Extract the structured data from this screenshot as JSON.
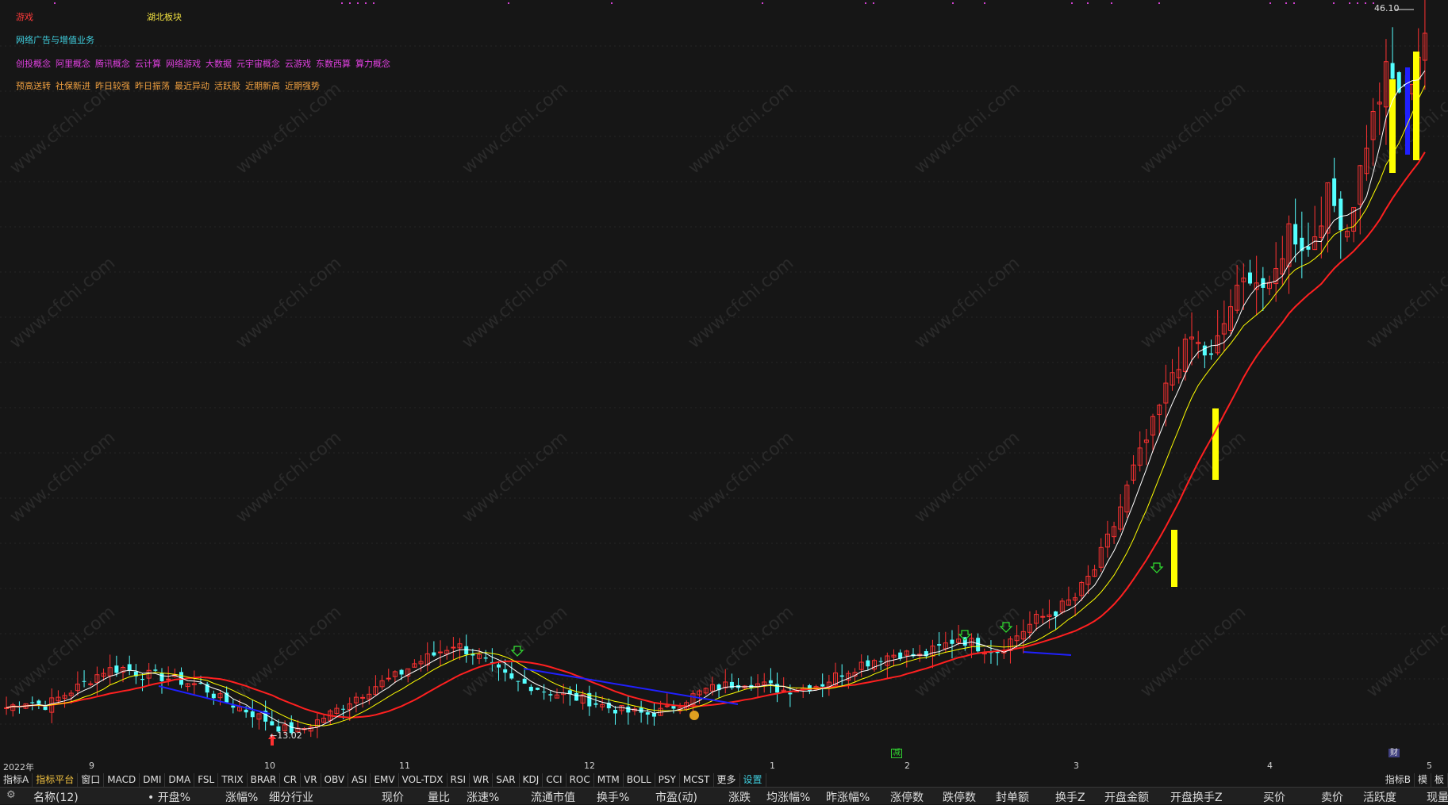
{
  "tags": {
    "sector1": "游戏",
    "sector2": "湖北板块",
    "industry": "网络广告与增值业务",
    "concepts": [
      "创投概念",
      "阿里概念",
      "腾讯概念",
      "云计算",
      "网络游戏",
      "大数据",
      "元宇宙概念",
      "云游戏",
      "东数西算",
      "算力概念"
    ],
    "styles": [
      "预高送转",
      "社保新进",
      "昨日较强",
      "昨日振荡",
      "最近异动",
      "活跃股",
      "近期新高",
      "近期强势"
    ]
  },
  "price_max_label": "46.10",
  "price_min_label": "←13.02",
  "date_axis": {
    "year": "2022年",
    "labels": [
      "9",
      "10",
      "11",
      "12",
      "1",
      "2",
      "3",
      "4",
      "5"
    ]
  },
  "markers": {
    "jian": "减",
    "caibao": "财"
  },
  "watermark": "www.cfchi.com",
  "indicator_tabs": [
    "指标A",
    "指标平台",
    "窗口",
    "MACD",
    "DMI",
    "DMA",
    "FSL",
    "TRIX",
    "BRAR",
    "CR",
    "VR",
    "OBV",
    "ASI",
    "EMV",
    "VOL-TDX",
    "RSI",
    "WR",
    "SAR",
    "KDJ",
    "CCI",
    "ROC",
    "MTM",
    "BOLL",
    "PSY",
    "MCST",
    "更多",
    "设置"
  ],
  "right_tabs": [
    "指标B",
    "模",
    "板"
  ],
  "columns": [
    "名称(12)",
    "• 开盘%",
    "涨幅%",
    "细分行业",
    "现价",
    "量比",
    "涨速%",
    "流通市值",
    "换手%",
    "市盈(动)",
    "涨跌",
    "均涨幅%",
    "昨涨幅%",
    "涨停数",
    "跌停数",
    "封单额",
    "换手Z",
    "开盘金额",
    "开盘换手Z",
    "买价",
    "卖价",
    "活跃度",
    "现量"
  ],
  "colors": {
    "up": "#ff3232",
    "down": "#54ffff",
    "ma1": "#ffffff",
    "ma2": "#ffff00",
    "ma3": "#ff2020",
    "ma_down": "#2020ff",
    "bg": "#161616"
  },
  "chart_data": {
    "type": "candlestick",
    "price_range": [
      13.02,
      46.1
    ],
    "description_keys": [
      "open",
      "high",
      "low",
      "close"
    ],
    "series": [
      {
        "name": "price",
        "values": [
          14.2,
          14.5,
          14.3,
          14.8,
          15.3,
          15.9,
          16.0,
          15.7,
          15.6,
          15.4,
          15.2,
          14.6,
          14.2,
          13.8,
          13.3,
          13.1,
          13.6,
          14.1,
          14.7,
          15.2,
          15.6,
          16.2,
          16.6,
          17.1,
          16.7,
          16.0,
          15.4,
          15.2,
          14.9,
          14.7,
          14.5,
          14.2,
          14.0,
          13.9,
          14.1,
          14.6,
          15.0,
          15.2,
          15.4,
          15.2,
          15.0,
          15.1,
          15.3,
          15.8,
          16.2,
          16.5,
          16.7,
          16.5,
          16.9,
          17.4,
          17.0,
          16.8,
          17.5,
          18.2,
          18.6,
          19.2,
          20.5,
          22.5,
          25.0,
          27.0,
          29.5,
          31.0,
          30.0,
          32.5,
          34.0,
          33.0,
          36.0,
          35.0,
          37.5,
          36.0,
          40.0,
          43.0,
          42.0,
          45.0
        ]
      }
    ]
  }
}
